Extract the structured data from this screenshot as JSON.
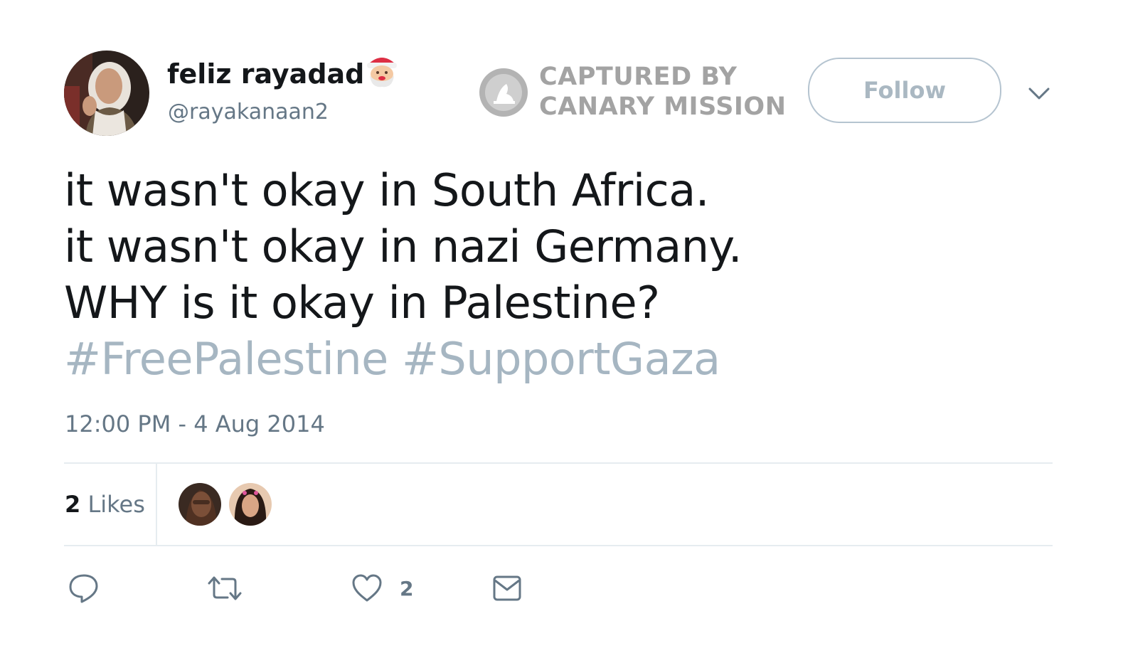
{
  "author": {
    "display_name": "feliz rayadad",
    "emoji_icon": "santa-claus-icon",
    "handle": "@rayakanaan2"
  },
  "watermark": {
    "line1": "CAPTURED BY",
    "line2": "CANARY MISSION",
    "icon": "canary-mission-logo-icon"
  },
  "follow_button": {
    "label": "Follow"
  },
  "caret_icon": "chevron-down-icon",
  "tweet": {
    "lines": [
      "it wasn't okay in South Africa.",
      "it wasn't okay in nazi Germany.",
      "WHY is it okay in Palestine?"
    ],
    "hashtags": [
      "#FreePalestine",
      "#SupportGaza"
    ],
    "timestamp": "12:00 PM - 4 Aug 2014"
  },
  "stats": {
    "likes_count": "2",
    "likes_label": "Likes"
  },
  "actions": {
    "reply_icon": "reply-icon",
    "retweet_icon": "retweet-icon",
    "like_icon": "heart-icon",
    "like_count": "2",
    "dm_icon": "envelope-icon"
  },
  "colors": {
    "text": "#14171a",
    "secondary": "#657786",
    "hashtag": "#a6b6c2",
    "border": "#e6ecf0",
    "watermark": "#a3a3a3"
  }
}
